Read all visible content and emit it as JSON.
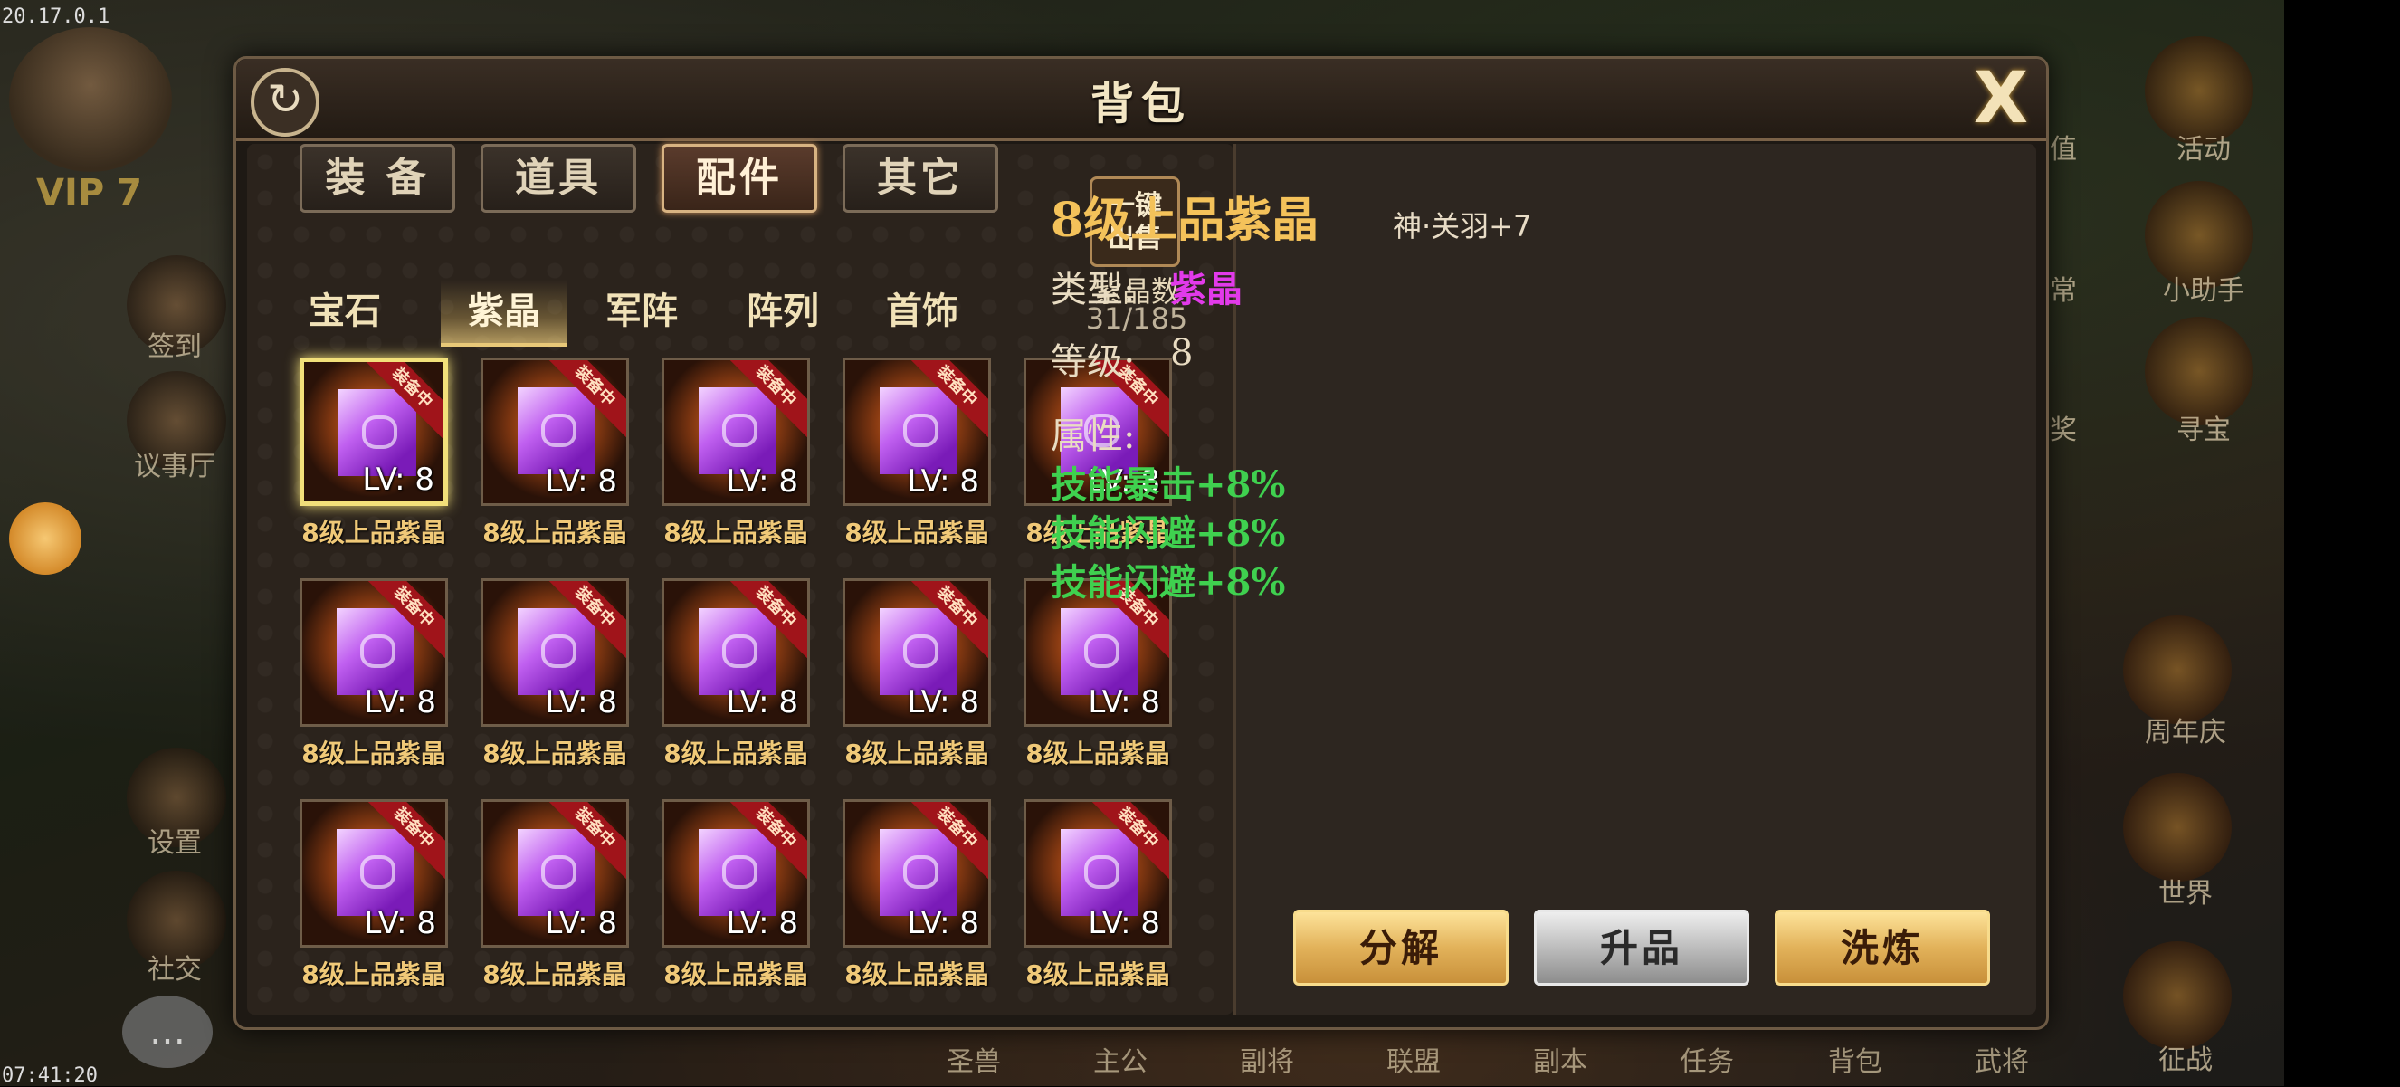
{
  "status": {
    "ip": "20.17.0.1",
    "clock": "07:41:20"
  },
  "hud_left": {
    "vip": "VIP 7",
    "items": [
      "签到",
      "议事厅",
      "设置",
      "社交"
    ]
  },
  "hud_right": {
    "items": [
      "充值",
      "活动",
      "日常",
      "小助手",
      "抽奖",
      "寻宝",
      "周年庆",
      "世界",
      "征战"
    ]
  },
  "bottom_nav": [
    "圣兽",
    "主公",
    "副将",
    "联盟",
    "副本",
    "任务",
    "背包",
    "武将"
  ],
  "panel": {
    "title": "背包",
    "refresh_icon": "↻",
    "close_icon": "X",
    "tabs": [
      {
        "label": "装 备",
        "active": false
      },
      {
        "label": "道具",
        "active": false
      },
      {
        "label": "配件",
        "active": true
      },
      {
        "label": "其它",
        "active": false
      }
    ],
    "sell_button_line1": "一键",
    "sell_button_line2": "出售",
    "count_label": "紫晶数",
    "count_value": "31/185",
    "subtabs": [
      {
        "label": "宝石",
        "active": false
      },
      {
        "label": "紫晶",
        "active": true
      },
      {
        "label": "军阵",
        "active": false
      },
      {
        "label": "阵列",
        "active": false
      },
      {
        "label": "首饰",
        "active": false
      }
    ],
    "grid": {
      "item_name": "8级上品紫晶",
      "level": "LV: 8",
      "badge": "装备中",
      "selected_index": 0,
      "count": 15
    }
  },
  "detail": {
    "title": "8级上品紫晶",
    "owner": "神·关羽+7",
    "type_label": "类型:",
    "type_value": "紫晶",
    "level_label": "等级:",
    "level_value": "8",
    "attr_label": "属性:",
    "attributes": [
      "技能暴击+8%",
      "技能闪避+8%",
      "技能闪避+8%"
    ],
    "buttons": {
      "decompose": "分解",
      "upgrade": "升品",
      "refine": "洗炼"
    }
  },
  "colors": {
    "gem_purple": "#c060f0",
    "type_magenta": "#e23aea",
    "attr_green": "#3fd04f",
    "title_gold": "#f4c25a"
  }
}
